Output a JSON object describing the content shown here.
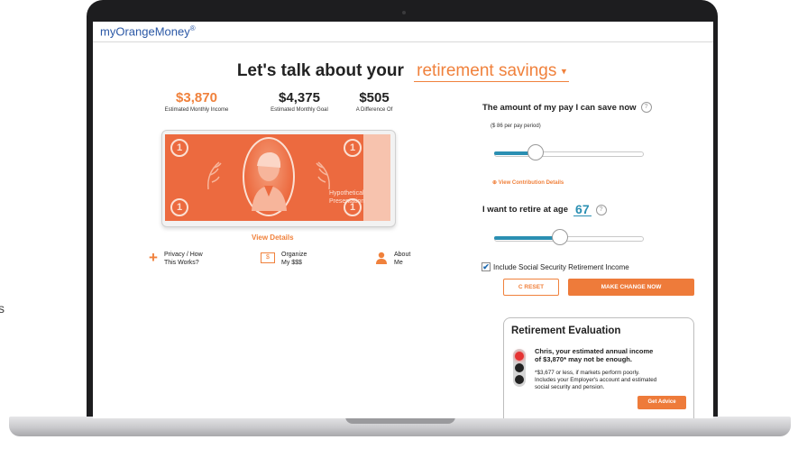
{
  "stray_text": "s",
  "app": {
    "logo": "myOrangeMoney",
    "logo_mark": "®",
    "headline_prefix": "Let's talk about your",
    "headline_dropdown": "retirement savings"
  },
  "stats": [
    {
      "value": "$3,870",
      "label": "Estimated Monthly Income"
    },
    {
      "value": "$4,375",
      "label": "Estimated Monthly Goal"
    },
    {
      "value": "$505",
      "label": "A Difference Of"
    }
  ],
  "bill": {
    "corner_mark": "1",
    "caption_line1": "Hypothetical",
    "caption_line2": "Presentation"
  },
  "links": {
    "view_details": "View Details",
    "privacy_l1": "Privacy / How",
    "privacy_l2": "This Works?",
    "organize_l1": "Organize",
    "organize_l2": "My $$$",
    "about_l1": "About",
    "about_l2": "Me"
  },
  "icons": {
    "bill_glyph": "$",
    "help_glyph": "?",
    "check_glyph": "✔",
    "caret_glyph": "▾"
  },
  "savings": {
    "title": "The amount of my pay I can save now",
    "note": "($ 86 per pay period)",
    "slider_fraction": 0.28,
    "contrib_link": "⊕ View Contribution Details"
  },
  "retire": {
    "title": "I want to retire at age",
    "age": "67",
    "slider_fraction": 0.44
  },
  "social_security": {
    "label": "Include Social Security Retirement Income",
    "checked": true
  },
  "buttons": {
    "reset": "C RESET",
    "change": "MAKE CHANGE NOW",
    "advice": "Get Advice"
  },
  "evaluation": {
    "title": "Retirement Evaluation",
    "main_l1": "Chris, your estimated annual income",
    "main_l2": "of $3,870* may not be enough.",
    "note_l1": "*$3,677 or less, if markets perform poorly.",
    "note_l2": "Includes your Employer's account and estimated",
    "note_l3": "social security and pension."
  },
  "colors": {
    "accent": "#f0813c",
    "bill": "#ec6a3f",
    "slider": "#2a8fb2",
    "logo": "#2b58a6",
    "light_red": "#e53333"
  }
}
